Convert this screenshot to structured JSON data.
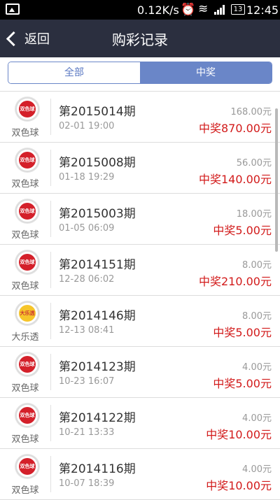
{
  "status_bar": {
    "network_speed": "0.12K/s",
    "battery": "13",
    "time": "12:45"
  },
  "header": {
    "back_label": "返回",
    "title": "购彩记录"
  },
  "tabs": [
    {
      "label": "全部",
      "active": false
    },
    {
      "label": "中奖",
      "active": true
    }
  ],
  "records": [
    {
      "lottery": "双色球",
      "logo_text": "双色球",
      "issue": "第2015014期",
      "date": "02-01 19:00",
      "amount": "168.00元",
      "prize": "中奖870.00元"
    },
    {
      "lottery": "双色球",
      "logo_text": "双色球",
      "issue": "第2015008期",
      "date": "01-18 19:29",
      "amount": "56.00元",
      "prize": "中奖140.00元"
    },
    {
      "lottery": "双色球",
      "logo_text": "双色球",
      "issue": "第2015003期",
      "date": "01-05 06:09",
      "amount": "18.00元",
      "prize": "中奖5.00元"
    },
    {
      "lottery": "双色球",
      "logo_text": "双色球",
      "issue": "第2014151期",
      "date": "12-28 06:02",
      "amount": "8.00元",
      "prize": "中奖210.00元"
    },
    {
      "lottery": "大乐透",
      "logo_text": "大乐透",
      "issue": "第2014146期",
      "date": "12-13 08:41",
      "amount": "8.00元",
      "prize": "中奖5.00元"
    },
    {
      "lottery": "双色球",
      "logo_text": "双色球",
      "issue": "第2014123期",
      "date": "10-23 16:07",
      "amount": "4.00元",
      "prize": "中奖5.00元"
    },
    {
      "lottery": "双色球",
      "logo_text": "双色球",
      "issue": "第2014122期",
      "date": "10-21 13:33",
      "amount": "4.00元",
      "prize": "中奖10.00元"
    },
    {
      "lottery": "双色球",
      "logo_text": "双色球",
      "issue": "第2014116期",
      "date": "10-07 18:39",
      "amount": "4.00元",
      "prize": "中奖10.00元"
    }
  ],
  "colors": {
    "header_bg": "#2b2f3f",
    "tab_accent": "#6a86c8",
    "prize_red": "#d21a1a"
  }
}
